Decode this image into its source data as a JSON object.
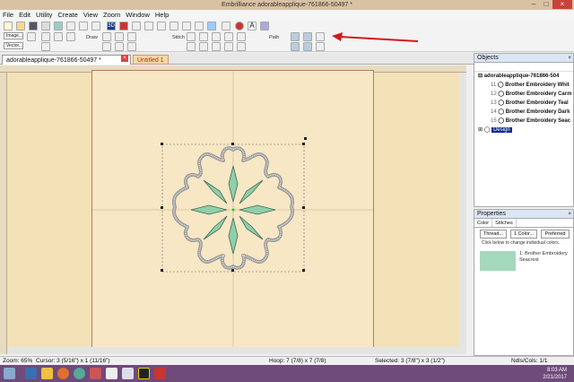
{
  "window": {
    "title": "Embrilliance    adorableapplique-761866-50497 *"
  },
  "menu": [
    "File",
    "Edit",
    "Utility",
    "Create",
    "View",
    "Zoom",
    "Window",
    "Help"
  ],
  "toolbar": {
    "image_label": "Image...",
    "vector_label": "Vector...",
    "draw_label": "Draw",
    "stitch_label": "Stitch",
    "path_label": "Path"
  },
  "tabs": [
    {
      "label": "adorableapplique-761866-50497 *"
    },
    {
      "label": "Untitled 1 *"
    }
  ],
  "objects": {
    "title": "Objects",
    "root": "adorableapplique-761866-504",
    "items": [
      {
        "num": "11",
        "label": "Brother Embroidery Whit"
      },
      {
        "num": "12",
        "label": "Brother Embroidery Carm"
      },
      {
        "num": "13",
        "label": "Brother Embroidery Teal"
      },
      {
        "num": "14",
        "label": "Brother Embroidery Dark"
      },
      {
        "num": "15",
        "label": "Brother Embroidery Seac"
      }
    ],
    "design": "Design"
  },
  "properties": {
    "title": "Properties",
    "tabs": [
      "Color",
      "Stitches"
    ],
    "buttons": [
      "Thread...",
      "1 Color...",
      "Preferred"
    ],
    "hint": "Click below to change individual colors.",
    "swatch_label": "1: Brother Embroidery Seacrest",
    "swatch_color": "#a4d9bd"
  },
  "status": {
    "zoom": "Zoom: 65%",
    "cursor": "Cursor: 3 (5/16\") x 1 (11/16\")",
    "hoop": "Hoop: 7 (7/8) x 7 (7/8)",
    "selected": "Selected: 3 (7/8\") x 3 (1/2\")",
    "ndls": "Ndls/Cols: 1/1"
  },
  "clock": {
    "time": "8:03 AM",
    "date": "2/21/2017"
  },
  "colors": {
    "canvas": "#f3e2b8",
    "hoop": "#f7e7c4",
    "taskbar": "#6e4b7a",
    "applique": "#8fcfaa"
  }
}
